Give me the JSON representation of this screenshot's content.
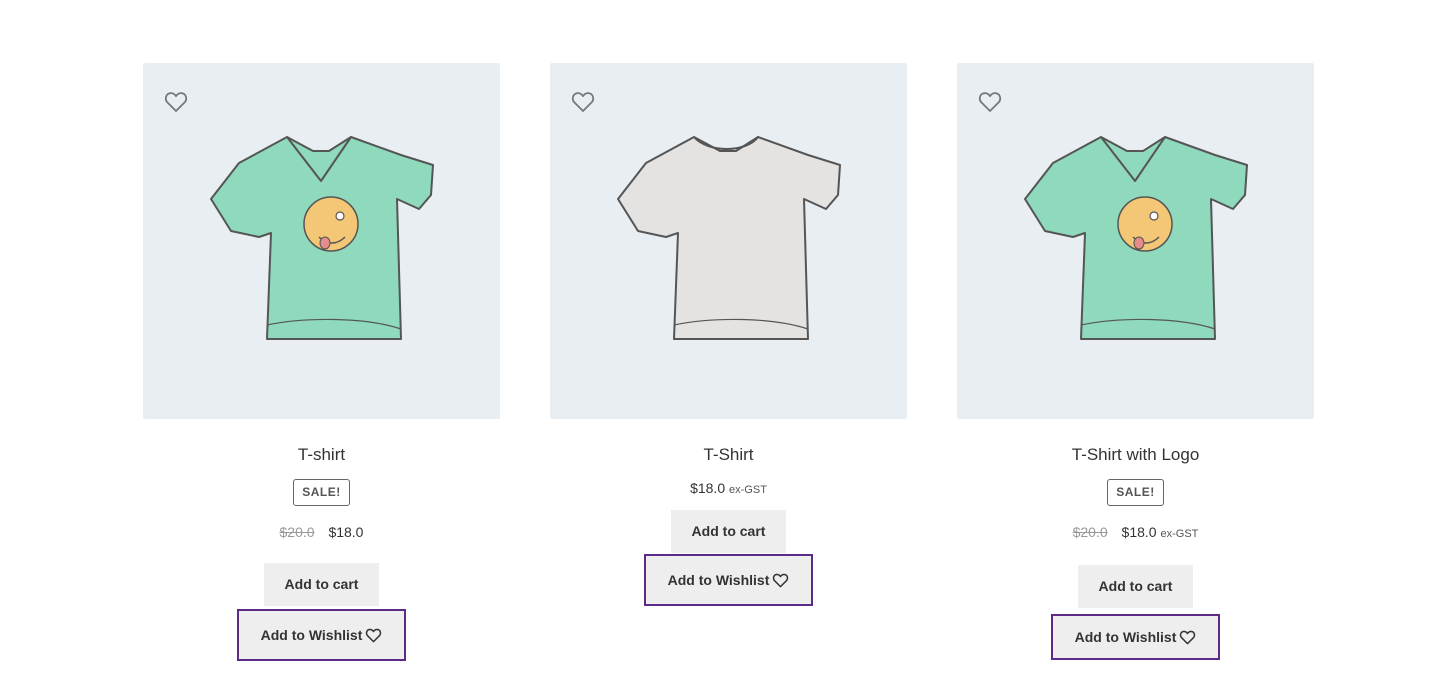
{
  "products": [
    {
      "name": "T-shirt",
      "sale_badge": "SALE!",
      "old_price": "$20.0",
      "price": "$18.0",
      "tax_label": "",
      "add_to_cart": "Add to cart",
      "add_to_wishlist": "Add to Wishlist",
      "shirt_color": "#8fd9bd",
      "has_logo": true
    },
    {
      "name": "T-Shirt",
      "price": "$18.0",
      "tax_label": "ex-GST",
      "add_to_cart": "Add to cart",
      "add_to_wishlist": "Add to Wishlist",
      "shirt_color": "#e4e3e1",
      "has_logo": false
    },
    {
      "name": "T-Shirt with Logo",
      "sale_badge": "SALE!",
      "old_price": "$20.0",
      "price": "$18.0",
      "tax_label": "ex-GST",
      "add_to_cart": "Add to cart",
      "add_to_wishlist": "Add to Wishlist",
      "shirt_color": "#8fd9bd",
      "has_logo": true
    }
  ],
  "colors": {
    "thumb_background": "#e8eef2",
    "wishlist_border": "#5b2b87",
    "button_background": "#eeeeee"
  },
  "icons": {
    "wishlist_corner": "heart-outline-icon",
    "wishlist_button": "heart-outline-icon"
  }
}
